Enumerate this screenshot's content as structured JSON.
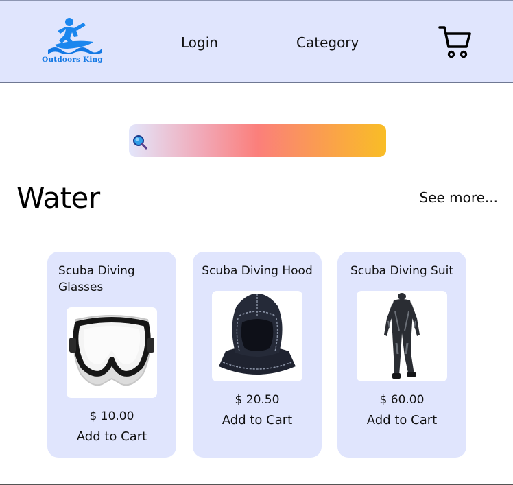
{
  "header": {
    "logo_text": "Outdoors King",
    "nav": {
      "login": "Login",
      "category": "Category"
    }
  },
  "search": {
    "value": "",
    "placeholder": ""
  },
  "section": {
    "title": "Water",
    "see_more": "See more..."
  },
  "products": [
    {
      "name": "Scuba Diving Glasses",
      "price": "$ 10.00",
      "add_to_cart": "Add to Cart"
    },
    {
      "name": "Scuba Diving Hood",
      "price": "$ 20.50",
      "add_to_cart": "Add to Cart"
    },
    {
      "name": "Scuba Diving Suit",
      "price": "$ 60.00",
      "add_to_cart": "Add to Cart"
    }
  ],
  "colors": {
    "header_bg": "#e0e5fd",
    "card_bg": "#e0e5fd",
    "brand_blue": "#1378e4",
    "search_gradient": [
      "#e3e6fb",
      "#fb7f7b",
      "#f9bd26"
    ]
  },
  "icons": {
    "logo": "surfer-logo-icon",
    "cart": "shopping-cart-icon",
    "search": "magnifier-icon"
  }
}
